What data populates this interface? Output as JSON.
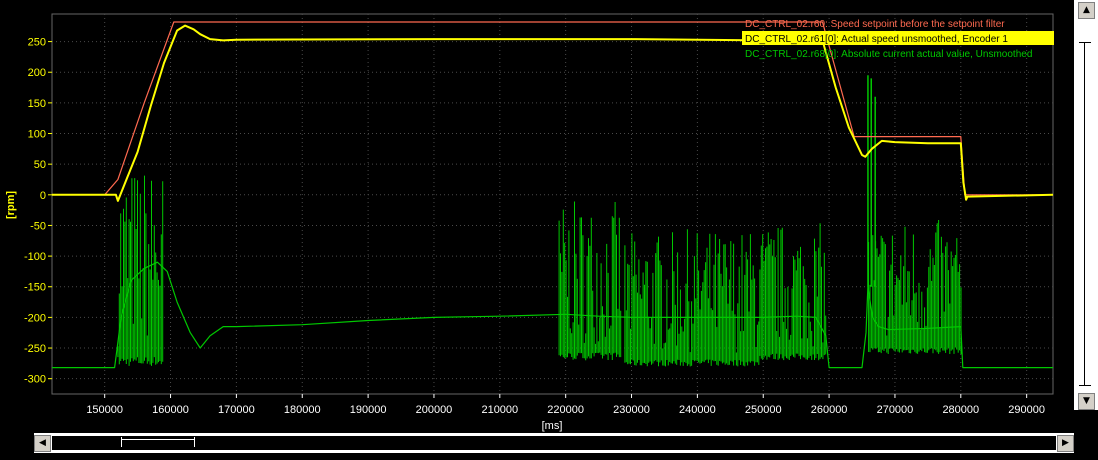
{
  "chart_data": {
    "type": "line",
    "title": "",
    "xlabel": "[ms]",
    "ylabel": "[rpm]",
    "xlim": [
      142000,
      294000
    ],
    "ylim": [
      -325,
      295
    ],
    "x_ticks": [
      150000,
      160000,
      170000,
      180000,
      190000,
      200000,
      210000,
      220000,
      230000,
      240000,
      250000,
      260000,
      270000,
      280000,
      290000
    ],
    "y_ticks": [
      250,
      200,
      150,
      100,
      50,
      0,
      -50,
      -100,
      -150,
      -200,
      -250,
      -300
    ],
    "grid": true,
    "legend_position": "top-right",
    "series": [
      {
        "name": "DC_CTRL_02.r60: Speed setpoint before the setpoint filter",
        "color": "#ff6a50",
        "x": [
          142000,
          150000,
          152000,
          156000,
          160500,
          259000,
          263800,
          280000,
          280600,
          294000
        ],
        "y": [
          0,
          0,
          25,
          150,
          282,
          282,
          95,
          95,
          0,
          0
        ]
      },
      {
        "name": "DC_CTRL_02.r61[0]: Actual speed unsmoothed, Encoder 1",
        "color": "#ffff00",
        "x": [
          142000,
          151700,
          152000,
          153500,
          155000,
          157000,
          159000,
          161000,
          162200,
          163500,
          164500,
          166000,
          168000,
          170000,
          200000,
          230000,
          250000,
          259000,
          261000,
          263000,
          265000,
          265500,
          266500,
          268000,
          270000,
          275000,
          280000,
          280400,
          280800,
          281000,
          294000
        ],
        "y": [
          0,
          0,
          -10,
          30,
          70,
          145,
          215,
          268,
          276,
          270,
          262,
          254,
          252,
          253,
          254,
          254,
          252,
          252,
          175,
          110,
          65,
          62,
          75,
          88,
          86,
          84,
          84,
          20,
          -8,
          -3,
          0
        ]
      },
      {
        "name": "DC_CTRL_02.r68[0]: Absolute current actual value, Unsmoothed",
        "color": "#00c800",
        "x": [
          142000,
          150000,
          151500,
          152500,
          154000,
          156000,
          158000,
          159500,
          161000,
          163000,
          164500,
          166000,
          168000,
          170000,
          180000,
          190000,
          200000,
          210000,
          220000,
          225000,
          230000,
          240000,
          250000,
          255000,
          258000,
          259500,
          260000,
          260500,
          265000,
          265600,
          265900,
          266600,
          267500,
          269000,
          275000,
          280000,
          280300,
          294000
        ],
        "y": [
          -282,
          -282,
          -282,
          -200,
          -140,
          -120,
          -110,
          -125,
          -175,
          -225,
          -250,
          -230,
          -215,
          -215,
          -212,
          -205,
          -200,
          -198,
          -195,
          -198,
          -200,
          -200,
          -200,
          -198,
          -200,
          -230,
          -282,
          -282,
          -282,
          -225,
          -150,
          -200,
          -215,
          -220,
          -218,
          -215,
          -282,
          -282
        ]
      }
    ],
    "noise_bands": [
      {
        "series": 2,
        "x": [
          152000,
          159000
        ],
        "y": [
          -280,
          50
        ]
      },
      {
        "series": 2,
        "x": [
          219000,
          228500
        ],
        "y": [
          -270,
          -10
        ]
      },
      {
        "series": 2,
        "x": [
          229000,
          237000
        ],
        "y": [
          -280,
          -60
        ]
      },
      {
        "series": 2,
        "x": [
          237000,
          249500
        ],
        "y": [
          -280,
          -55
        ]
      },
      {
        "series": 2,
        "x": [
          249500,
          259500
        ],
        "y": [
          -270,
          -45
        ]
      },
      {
        "series": 2,
        "x": [
          266000,
          280200
        ],
        "y": [
          -260,
          -40
        ]
      }
    ],
    "spikes": [
      {
        "series": 2,
        "x": 265900,
        "y": 195
      },
      {
        "series": 2,
        "x": 266400,
        "y": 190
      },
      {
        "series": 2,
        "x": 267000,
        "y": 160
      }
    ]
  }
}
